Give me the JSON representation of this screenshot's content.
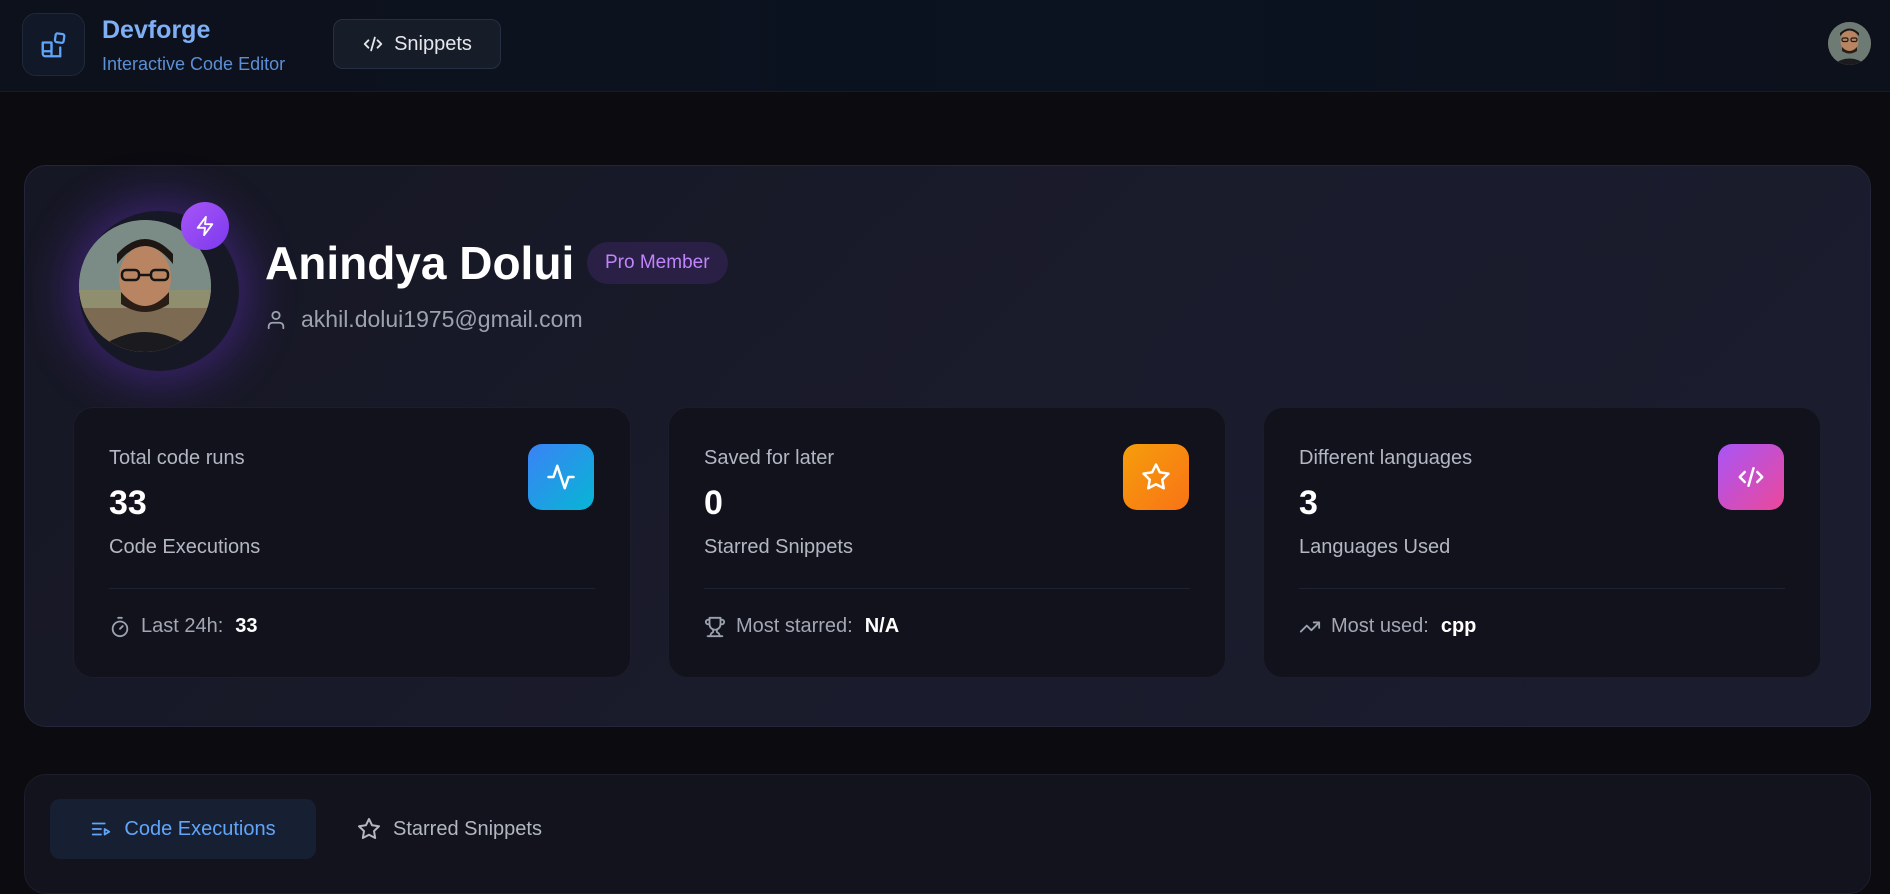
{
  "brand": {
    "name": "Devforge",
    "subtitle": "Interactive Code Editor"
  },
  "nav": {
    "snippets_label": "Snippets"
  },
  "profile": {
    "name": "Anindya Dolui",
    "badge": "Pro Member",
    "email": "akhil.dolui1975@gmail.com"
  },
  "stats": [
    {
      "label": "Total code runs",
      "value": "33",
      "sub": "Code Executions",
      "foot_label": "Last 24h:",
      "foot_value": "33",
      "icon": "activity-icon",
      "foot_icon": "timer-icon",
      "color_from": "#3b82f6",
      "color_to": "#06b6d4"
    },
    {
      "label": "Saved for later",
      "value": "0",
      "sub": "Starred Snippets",
      "foot_label": "Most starred:",
      "foot_value": "N/A",
      "icon": "star-icon",
      "foot_icon": "trophy-icon",
      "color_from": "#f59e0b",
      "color_to": "#f97316"
    },
    {
      "label": "Different languages",
      "value": "3",
      "sub": "Languages Used",
      "foot_label": "Most used:",
      "foot_value": "cpp",
      "icon": "code-icon",
      "foot_icon": "trending-up-icon",
      "color_from": "#a855f7",
      "color_to": "#ec4899"
    }
  ],
  "tabs": [
    {
      "label": "Code Executions",
      "active": true
    },
    {
      "label": "Starred Snippets",
      "active": false
    }
  ]
}
